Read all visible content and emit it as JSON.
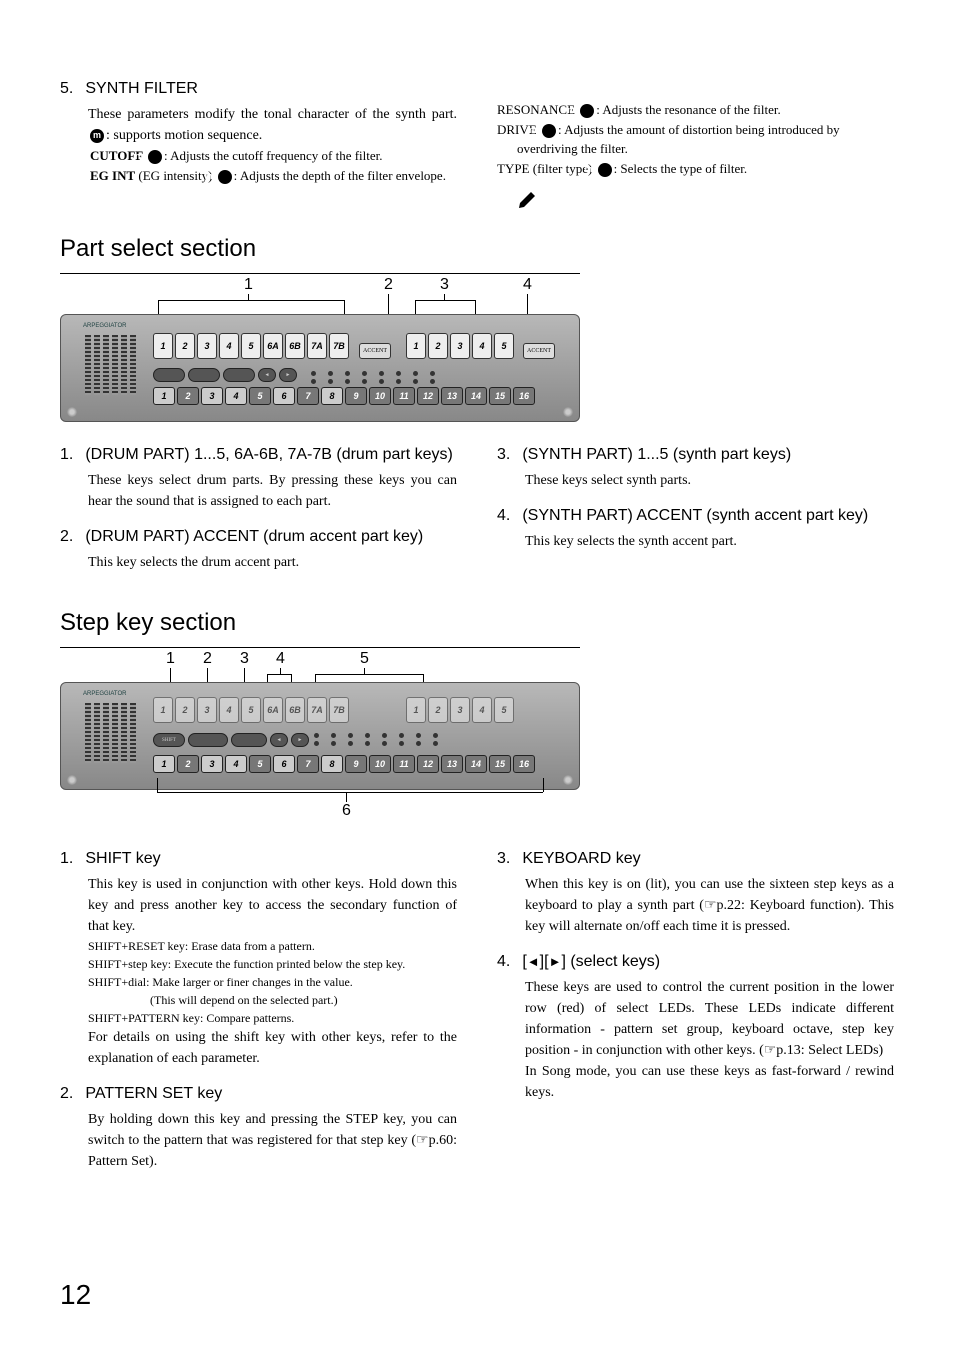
{
  "sections": {
    "synth_filter": {
      "num": "5.",
      "title": "SYNTH FILTER",
      "intro": "These parameters modify the tonal character of the synth part. ",
      "intro_suffix": ": supports motion sequence.",
      "items": {
        "cutoff": {
          "label": "CUTOFF ",
          "desc": ": Adjusts the cutoff frequency of the filter."
        },
        "egint": {
          "label": "EG INT",
          "paren": " (EG intensity) ",
          "desc": ": Adjusts the depth of the filter envelope."
        },
        "resonance": {
          "label": "RESONANCE ",
          "desc": ": Adjusts the resonance of the filter."
        },
        "drive": {
          "label": "DRIVE ",
          "desc": ": Adjusts the amount of distortion being introduced by overdriving the filter."
        },
        "type": {
          "label": "TYPE (filter type) ",
          "desc": ": Selects the type of filter."
        }
      }
    },
    "part_select": {
      "heading": "Part select section",
      "diagram_labels": [
        "1",
        "2",
        "3",
        "4"
      ],
      "drum_keys": [
        "1",
        "2",
        "3",
        "4",
        "5",
        "6A",
        "6B",
        "7A",
        "7B"
      ],
      "synth_keys": [
        "1",
        "2",
        "3",
        "4",
        "5"
      ],
      "step_keys": [
        "1",
        "2",
        "3",
        "4",
        "5",
        "6",
        "7",
        "8",
        "9",
        "10",
        "11",
        "12",
        "13",
        "14",
        "15",
        "16"
      ],
      "accent_label": "ACCENT",
      "items": {
        "i1": {
          "num": "1.",
          "title": "(DRUM PART) 1...5, 6A-6B, 7A-7B (drum part keys)",
          "body": "These keys select drum parts. By pressing these keys you can hear the sound that is assigned to each part."
        },
        "i2": {
          "num": "2.",
          "title": "(DRUM PART) ACCENT (drum accent part key)",
          "body": "This key selects the drum accent part."
        },
        "i3": {
          "num": "3.",
          "title": "(SYNTH PART) 1...5 (synth part keys)",
          "body": "These keys select synth parts."
        },
        "i4": {
          "num": "4.",
          "title": "(SYNTH PART) ACCENT (synth accent part key)",
          "body": "This key selects the synth accent part."
        }
      }
    },
    "step_key": {
      "heading": "Step key section",
      "diagram_labels": [
        "1",
        "2",
        "3",
        "4",
        "5",
        "6"
      ],
      "btn_shift": "SHIFT",
      "btn_pattern": "PATTERN SET",
      "btn_keyboard": "KEYBOARD",
      "arrow_left": "◄",
      "arrow_right": "►",
      "items": {
        "i1": {
          "num": "1.",
          "title": "SHIFT key",
          "body": "This key is used in conjunction with other keys. Hold down this key and press another key to access the secondary function of that key.",
          "sub1": "SHIFT+RESET key: Erase data from a pattern.",
          "sub2": "SHIFT+step key: Execute the function printed below the step key.",
          "sub3": "SHIFT+dial: Make larger or finer changes in the value.",
          "sub3b": "(This will depend on the selected part.)",
          "sub4": "SHIFT+PATTERN key: Compare patterns.",
          "body2": "For details on using the shift key with other keys, refer to the explanation of each parameter."
        },
        "i2": {
          "num": "2.",
          "title": "PATTERN SET key",
          "body": "By holding down this key and pressing the STEP key, you can switch to the pattern that was registered for that step key (☞p.60: Pattern Set)."
        },
        "i3": {
          "num": "3.",
          "title": "KEYBOARD key",
          "body": "When this key is on (lit), you can use the sixteen step keys as a keyboard to play a synth part (☞p.22: Keyboard function). This key will alternate on/off each time it is pressed."
        },
        "i4": {
          "num": "4.",
          "title_prefix": "[",
          "title_arrow1": "◄",
          "title_mid": "][",
          "title_arrow2": "►",
          "title_suffix": "] (select keys)",
          "body": "These keys are used to control the current position in the lower row (red) of select LEDs. These LEDs indicate different information - pattern set group, keyboard octave, step key position - in conjunction with other keys. (☞p.13: Select LEDs)",
          "body2": "In Song mode, you can use these keys as fast-forward / rewind keys."
        }
      }
    }
  },
  "page_number": "12"
}
